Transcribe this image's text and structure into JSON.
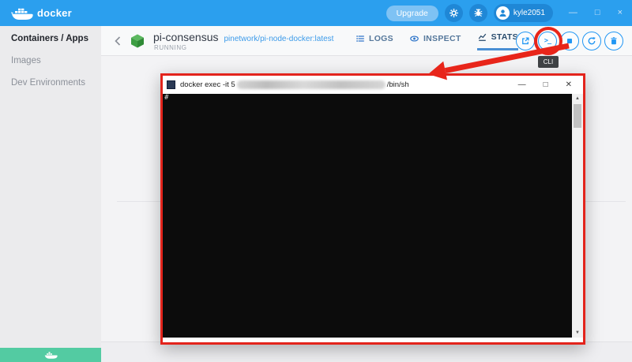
{
  "header": {
    "brand": "docker",
    "upgrade_label": "Upgrade",
    "username": "kyle2051",
    "minimize": "—",
    "maximize": "□",
    "close": "×"
  },
  "sidebar": {
    "items": [
      "Containers / Apps",
      "Images",
      "Dev Environments"
    ]
  },
  "container": {
    "name": "pi-consensus",
    "image": "pinetwork/pi-node-docker:latest",
    "status": "RUNNING"
  },
  "tabs": {
    "logs": "LOGS",
    "inspect": "INSPECT",
    "stats": "STATS"
  },
  "icons": {
    "cli": ">_"
  },
  "tooltip": {
    "cli": "CLI"
  },
  "terminal": {
    "title_prefix": "docker exec  -it 5",
    "title_suffix": "/bin/sh",
    "prompt": "#",
    "minimize": "—",
    "maximize": "□",
    "close": "✕",
    "scroll_up": "▲",
    "scroll_down": "▼"
  },
  "colors": {
    "header_blue": "#2b9fee",
    "accent_blue": "#2196f3",
    "annotation_red": "#e8251a",
    "footer_teal": "#53cba2",
    "cube_green": "#3d9e43"
  }
}
